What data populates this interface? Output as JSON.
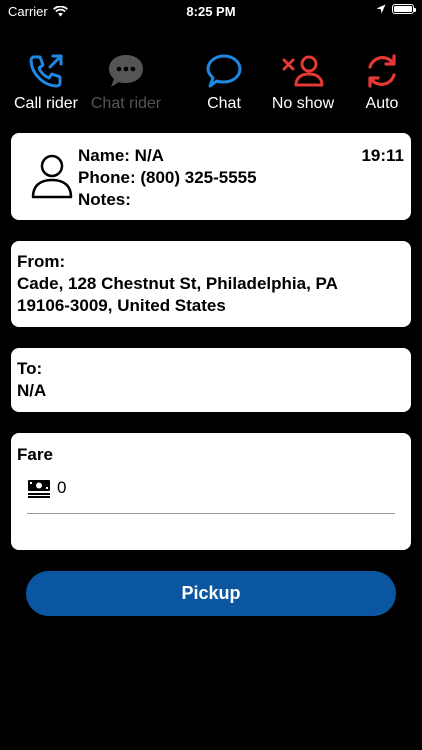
{
  "status_bar": {
    "carrier": "Carrier",
    "time": "8:25 PM"
  },
  "toolbar": {
    "actions": [
      {
        "label": "Call rider",
        "icon": "phone-call-icon",
        "color": "#1e88e5",
        "enabled": true
      },
      {
        "label": "Chat rider",
        "icon": "chat-bubble-dots-icon",
        "color": "#555555",
        "enabled": false
      },
      {
        "label": "Chat",
        "icon": "chat-bubble-icon",
        "color": "#1e88e5",
        "enabled": true
      },
      {
        "label": "No show",
        "icon": "user-x-icon",
        "color": "#e53935",
        "enabled": true
      },
      {
        "label": "Auto",
        "icon": "refresh-icon",
        "color": "#e53935",
        "enabled": true
      }
    ]
  },
  "rider": {
    "name": "Name: N/A",
    "phone": "Phone: (800) 325-5555",
    "notes": "Notes:",
    "time": "19:11"
  },
  "from": {
    "title": "From:",
    "address_line1": "Cade, 128 Chestnut St, Philadelphia, PA",
    "address_line2": "19106-3009, United States"
  },
  "to": {
    "title": "To:",
    "value": "N/A"
  },
  "fare": {
    "title": "Fare",
    "value": "0"
  },
  "pickup_button": {
    "label": "Pickup",
    "color": "#0b56a0"
  }
}
